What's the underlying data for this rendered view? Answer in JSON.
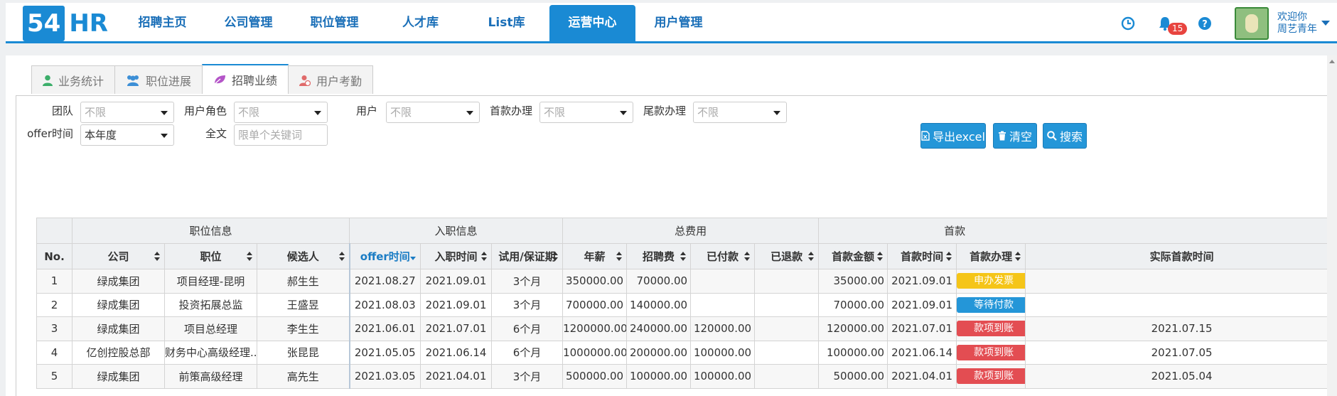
{
  "logo": {
    "num": "54",
    "text": "HR"
  },
  "nav": [
    {
      "label": "招聘主页"
    },
    {
      "label": "公司管理"
    },
    {
      "label": "职位管理"
    },
    {
      "label": "人才库"
    },
    {
      "label": "List库"
    },
    {
      "label": "运营中心",
      "active": true
    },
    {
      "label": "用户管理"
    }
  ],
  "header": {
    "notification_count": "15",
    "welcome_line1": "欢迎你",
    "welcome_line2": "周艺青年"
  },
  "tabs": [
    {
      "label": "业务统计",
      "icon": "user-icon"
    },
    {
      "label": "职位进展",
      "icon": "users-icon"
    },
    {
      "label": "招聘业绩",
      "icon": "leaf-icon",
      "active": true
    },
    {
      "label": "用户考勤",
      "icon": "user-clock-icon"
    }
  ],
  "filters": {
    "team_label": "团队",
    "team_value": "不限",
    "role_label": "用户角色",
    "role_value": "不限",
    "user_label": "用户",
    "user_value": "不限",
    "first_label": "首款办理",
    "first_value": "不限",
    "final_label": "尾款办理",
    "final_value": "不限",
    "offer_label": "offer时间",
    "offer_value": "本年度",
    "fulltext_label": "全文",
    "fulltext_placeholder": "限单个关键词"
  },
  "buttons": {
    "export": "导出excel",
    "clear": "清空",
    "search": "搜索"
  },
  "table": {
    "groups": [
      {
        "label": "",
        "span": 1
      },
      {
        "label": "职位信息",
        "span": 3
      },
      {
        "label": "入职信息",
        "span": 3
      },
      {
        "label": "总费用",
        "span": 4
      },
      {
        "label": "首款",
        "span": 4
      }
    ],
    "headers": [
      "No.",
      "公司",
      "职位",
      "候选人",
      "offer时间",
      "入职时间",
      "试用/保证期",
      "年薪",
      "招聘费",
      "已付款",
      "已退款",
      "首款金额",
      "首款时间",
      "首款办理",
      "实际首款时间"
    ],
    "rows": [
      {
        "no": "1",
        "company": "绿成集团",
        "position": "项目经理-昆明",
        "candidate": "郝生生",
        "offer": "2021.08.27",
        "entry": "2021.09.01",
        "trial": "3个月",
        "salary": "350000.00",
        "fee": "70000.00",
        "paid": "",
        "refund": "",
        "first_amount": "35000.00",
        "first_time": "2021.09.01",
        "first_status": "申办发票",
        "status_color": "y",
        "actual_first": ""
      },
      {
        "no": "2",
        "company": "绿成集团",
        "position": "投资拓展总监",
        "candidate": "王盛昱",
        "offer": "2021.08.03",
        "entry": "2021.09.01",
        "trial": "3个月",
        "salary": "700000.00",
        "fee": "140000.00",
        "paid": "",
        "refund": "",
        "first_amount": "70000.00",
        "first_time": "2021.09.01",
        "first_status": "等待付款",
        "status_color": "b",
        "actual_first": ""
      },
      {
        "no": "3",
        "company": "绿成集团",
        "position": "项目总经理",
        "candidate": "李生生",
        "offer": "2021.06.01",
        "entry": "2021.07.01",
        "trial": "6个月",
        "salary": "1200000.00",
        "fee": "240000.00",
        "paid": "120000.00",
        "refund": "",
        "first_amount": "120000.00",
        "first_time": "2021.07.01",
        "first_status": "款项到账",
        "status_color": "r",
        "actual_first": "2021.07.15"
      },
      {
        "no": "4",
        "company": "亿创控股总部",
        "position": "财务中心高级经理...",
        "candidate": "张昆昆",
        "offer": "2021.05.05",
        "entry": "2021.06.14",
        "trial": "6个月",
        "salary": "1000000.00",
        "fee": "200000.00",
        "paid": "100000.00",
        "refund": "",
        "first_amount": "100000.00",
        "first_time": "2021.06.14",
        "first_status": "款项到账",
        "status_color": "r",
        "actual_first": "2021.07.05"
      },
      {
        "no": "5",
        "company": "绿成集团",
        "position": "前策高级经理",
        "candidate": "高先生",
        "offer": "2021.03.05",
        "entry": "2021.04.01",
        "trial": "3个月",
        "salary": "500000.00",
        "fee": "100000.00",
        "paid": "100000.00",
        "refund": "",
        "first_amount": "50000.00",
        "first_time": "2021.04.01",
        "first_status": "款项到账",
        "status_color": "r",
        "actual_first": "2021.05.04"
      }
    ]
  },
  "colors": {
    "brand": "#1a8ad4",
    "tag_yellow": "#f5c518",
    "tag_blue": "#2496d8",
    "tag_red": "#e34d52"
  }
}
